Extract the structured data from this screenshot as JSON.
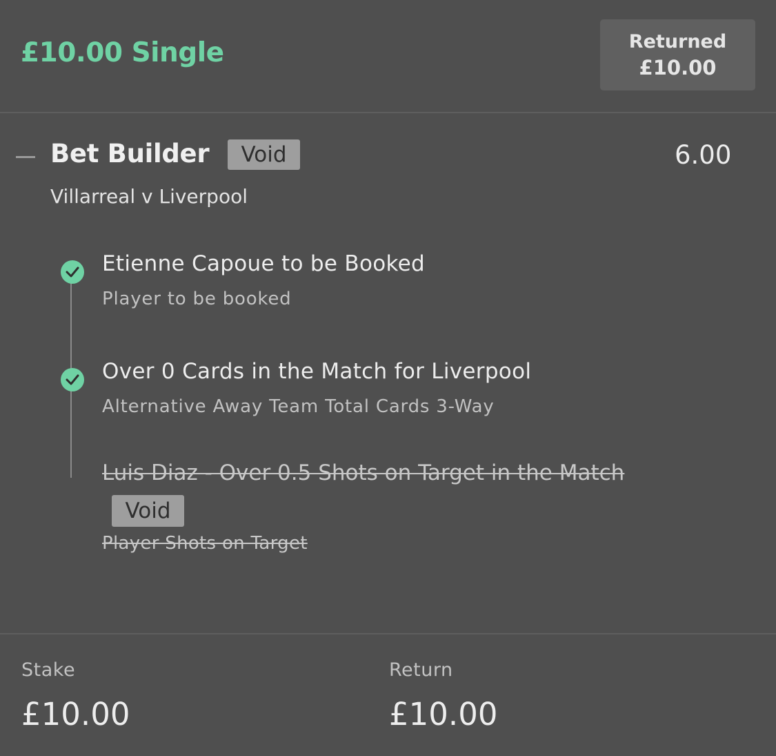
{
  "header": {
    "title": "£10.00 Single",
    "returned_label": "Returned",
    "returned_amount": "£10.00"
  },
  "bet_builder": {
    "title": "Bet Builder",
    "status_badge": "Void",
    "odds": "6.00",
    "match": "Villarreal v Liverpool"
  },
  "legs": [
    {
      "title": "Etienne Capoue to be Booked",
      "market": "Player to be booked",
      "status": "won",
      "icon": "check-icon"
    },
    {
      "title": "Over 0 Cards in the Match for Liverpool",
      "market": "Alternative Away Team Total Cards 3-Way",
      "status": "won",
      "icon": "check-icon"
    },
    {
      "title": "Luis Diaz - Over 0.5 Shots on Target in the Match",
      "market": "Player Shots on Target",
      "status": "void",
      "badge": "Void"
    }
  ],
  "footer": {
    "stake_label": "Stake",
    "stake_value": "£10.00",
    "return_label": "Return",
    "return_value": "£10.00"
  },
  "colors": {
    "background": "#4f4f4f",
    "accent_green": "#6fd2a4",
    "returned_box": "#606060",
    "void_badge": "#9e9e9e"
  }
}
